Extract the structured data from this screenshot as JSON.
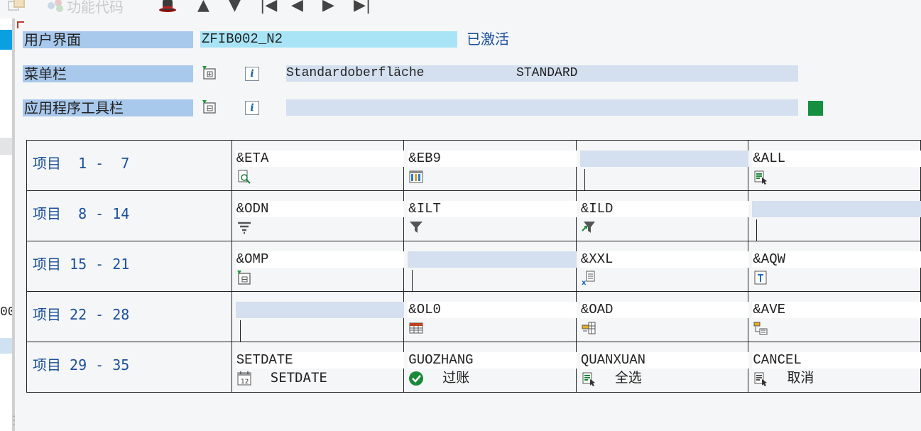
{
  "toolbar": {
    "function_code_label": "功能代码",
    "items": [
      {
        "name": "arrow-up",
        "glyph": "▲"
      },
      {
        "name": "arrow-down",
        "glyph": "▼"
      },
      {
        "name": "first-page",
        "glyph": "|◀"
      },
      {
        "name": "prev-page",
        "glyph": "◀"
      },
      {
        "name": "next-page",
        "glyph": "▶"
      },
      {
        "name": "last-page",
        "glyph": "▶|"
      }
    ]
  },
  "header": {
    "user_interface_label": "用户界面",
    "user_interface_value": "ZFIB002_N2",
    "status": "已激活",
    "menu_bar_label": "菜单栏",
    "menu_bar_value": "Standardoberfläche            STANDARD",
    "app_toolbar_label": "应用程序工具栏",
    "app_toolbar_value": ""
  },
  "colors": {
    "label_bg": "#a8c8ec",
    "active_value_bg": "#a8e4f5",
    "field_bg": "#d4dfef",
    "status_text": "#1a4f9c",
    "green_status": "#159040"
  },
  "grid": {
    "rows": [
      {
        "label": "项目  1 -  7",
        "cells": [
          {
            "code": "&ETA",
            "icon": "find-icon",
            "text": ""
          },
          {
            "code": "&EB9",
            "icon": "table-layout-icon",
            "text": ""
          },
          {
            "code": "",
            "icon": "",
            "text": ""
          },
          {
            "code": "&ALL",
            "icon": "select-all-icon",
            "text": ""
          }
        ]
      },
      {
        "label": "项目  8 - 14",
        "cells": [
          {
            "code": "&ODN",
            "icon": "sort-descending-icon",
            "text": ""
          },
          {
            "code": "&ILT",
            "icon": "filter-icon",
            "text": ""
          },
          {
            "code": "&ILD",
            "icon": "filter-delete-icon",
            "text": ""
          },
          {
            "code": "",
            "icon": "",
            "text": ""
          }
        ]
      },
      {
        "label": "项目 15 - 21",
        "cells": [
          {
            "code": "&OMP",
            "icon": "document-add-icon",
            "text": ""
          },
          {
            "code": "",
            "icon": "",
            "text": ""
          },
          {
            "code": "&XXL",
            "icon": "excel-export-icon",
            "text": ""
          },
          {
            "code": "&AQW",
            "icon": "text-document-icon",
            "text": ""
          }
        ]
      },
      {
        "label": "项目 22 - 28",
        "cells": [
          {
            "code": "",
            "icon": "",
            "text": ""
          },
          {
            "code": "&OL0",
            "icon": "layout-grid-icon",
            "text": ""
          },
          {
            "code": "&OAD",
            "icon": "layout-select-icon",
            "text": ""
          },
          {
            "code": "&AVE",
            "icon": "layout-save-icon",
            "text": ""
          }
        ]
      },
      {
        "label": "项目 29 - 35",
        "cells": [
          {
            "code": "SETDATE",
            "icon": "calendar-icon",
            "text": "SETDATE"
          },
          {
            "code": "GUOZHANG",
            "icon": "check-icon",
            "text": "过账"
          },
          {
            "code": "QUANXUAN",
            "icon": "select-all-icon",
            "text": "全选"
          },
          {
            "code": "CANCEL",
            "icon": "deselect-all-icon",
            "text": "取消"
          }
        ]
      }
    ]
  }
}
